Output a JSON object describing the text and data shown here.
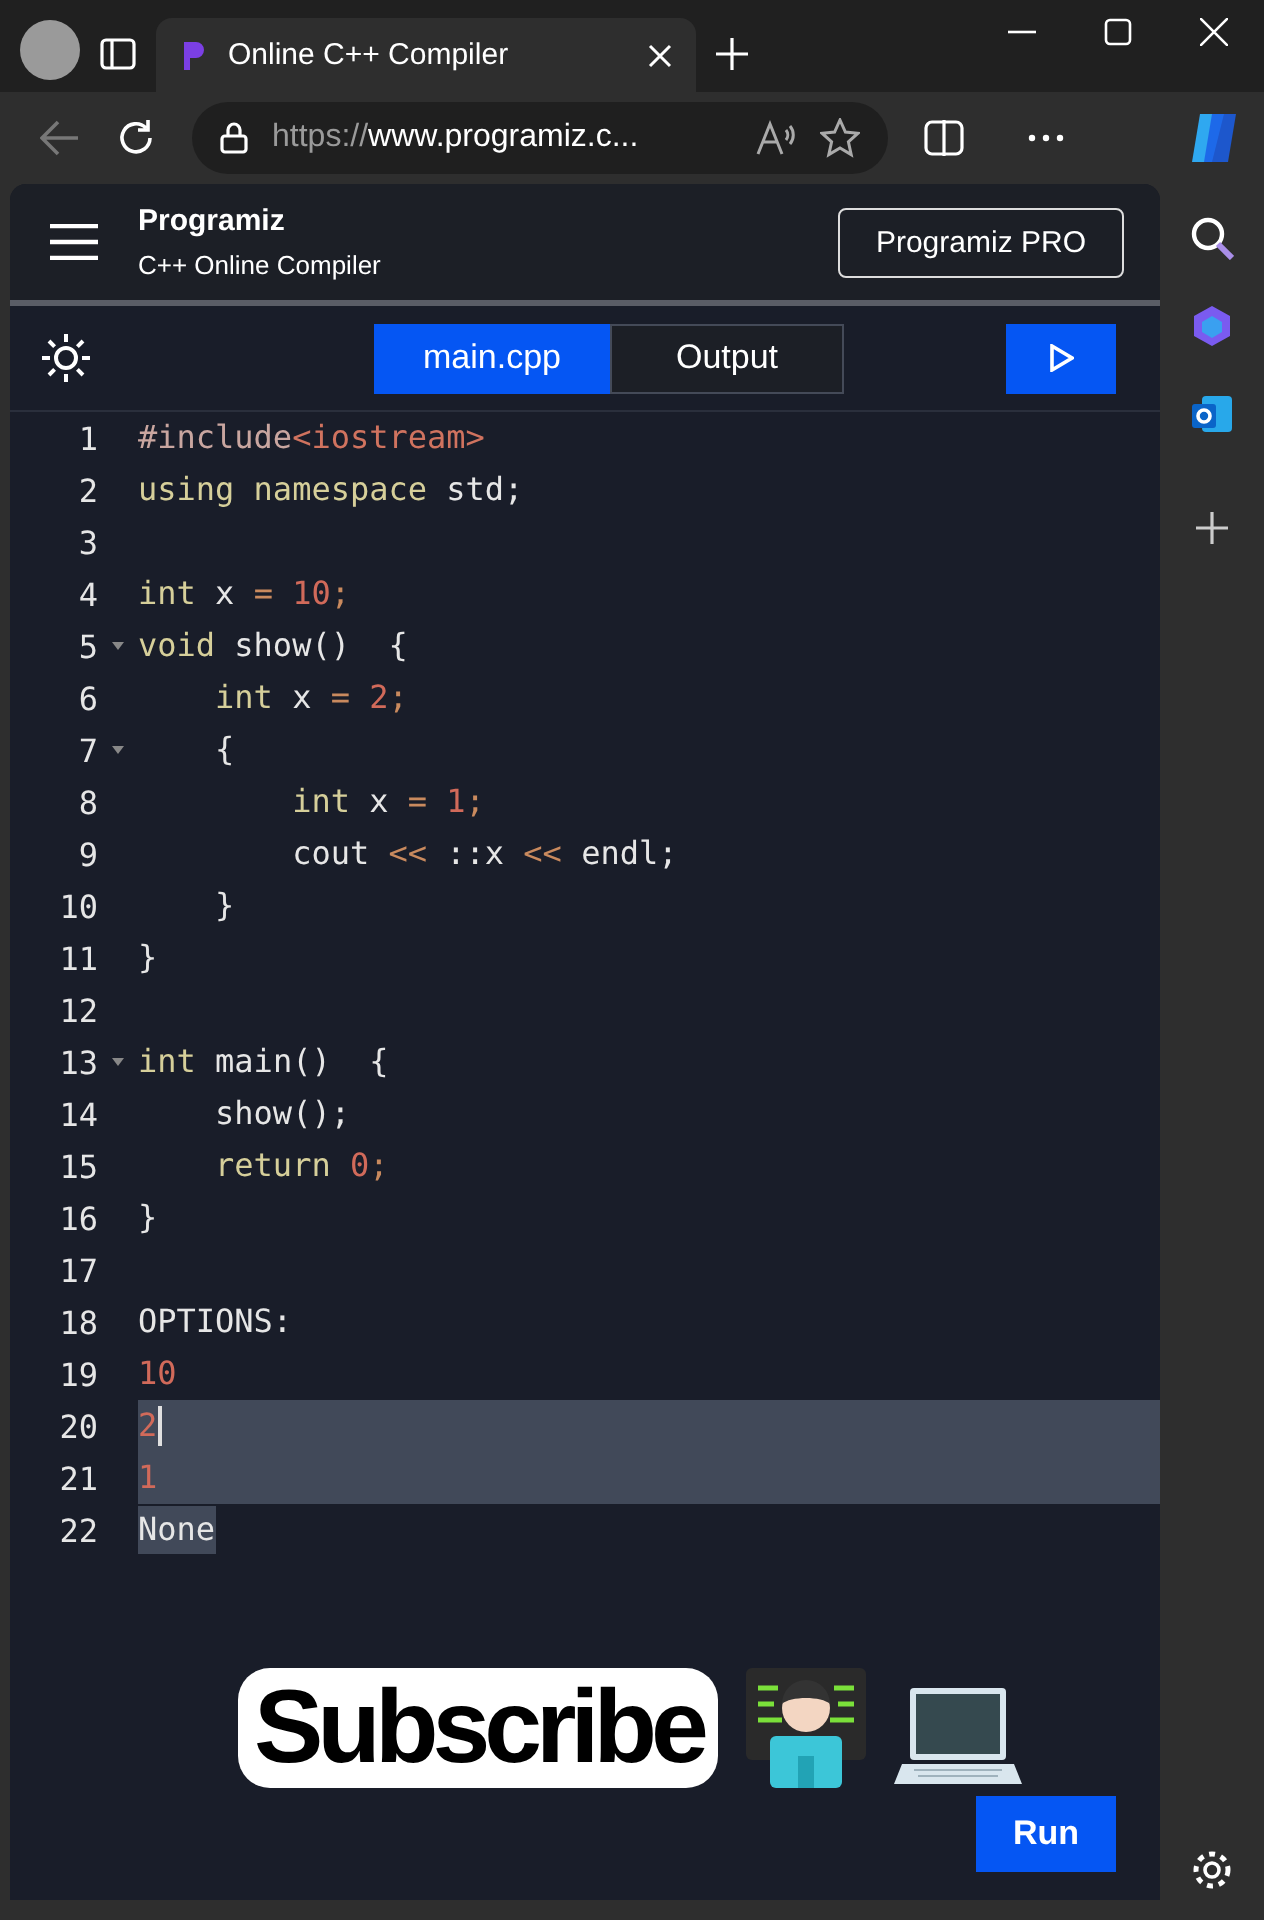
{
  "browser": {
    "tab_title": "Online C++ Compiler",
    "url_scheme": "https://",
    "url_rest": "www.programiz.c..."
  },
  "header": {
    "logo": "Programiz",
    "subtitle": "C++ Online Compiler",
    "pro_button": "Programiz PRO"
  },
  "tabs": [
    {
      "label": "main.cpp",
      "selected": true
    },
    {
      "label": "Output",
      "selected": false
    }
  ],
  "editor": {
    "lines": [
      {
        "number": "1",
        "tokens": [
          {
            "text": "#include",
            "kind": "directive"
          },
          {
            "text": "<iostream>",
            "kind": "string"
          }
        ]
      },
      {
        "number": "2",
        "tokens": [
          {
            "text": "using namespace",
            "kind": "keyword"
          },
          {
            "text": " std;",
            "kind": "plain"
          }
        ]
      },
      {
        "number": "3"
      },
      {
        "number": "4",
        "tokens": [
          {
            "text": "int",
            "kind": "keyword"
          },
          {
            "text": " x ",
            "kind": "plain"
          },
          {
            "text": "=",
            "kind": "operator"
          },
          {
            "text": " 10",
            "kind": "number"
          },
          {
            "text": ";",
            "kind": "operator"
          }
        ]
      },
      {
        "number": "5",
        "foldable": true,
        "tokens": [
          {
            "text": "void",
            "kind": "keyword"
          },
          {
            "text": " show()  {",
            "kind": "plain"
          }
        ]
      },
      {
        "number": "6",
        "tokens": [
          {
            "text": "    int",
            "kind": "keyword"
          },
          {
            "text": " x ",
            "kind": "plain"
          },
          {
            "text": "=",
            "kind": "operator"
          },
          {
            "text": " 2",
            "kind": "number"
          },
          {
            "text": ";",
            "kind": "operator"
          }
        ]
      },
      {
        "number": "7",
        "foldable": true,
        "tokens": [
          {
            "text": "    {",
            "kind": "plain"
          }
        ]
      },
      {
        "number": "8",
        "tokens": [
          {
            "text": "        int",
            "kind": "keyword"
          },
          {
            "text": " x ",
            "kind": "plain"
          },
          {
            "text": "=",
            "kind": "operator"
          },
          {
            "text": " 1",
            "kind": "number"
          },
          {
            "text": ";",
            "kind": "operator"
          }
        ]
      },
      {
        "number": "9",
        "tokens": [
          {
            "text": "        cout ",
            "kind": "plain"
          },
          {
            "text": "<<",
            "kind": "operator"
          },
          {
            "text": " ::x ",
            "kind": "plain"
          },
          {
            "text": "<<",
            "kind": "operator"
          },
          {
            "text": " endl;",
            "kind": "plain"
          }
        ]
      },
      {
        "number": "10",
        "tokens": [
          {
            "text": "    }",
            "kind": "plain"
          }
        ]
      },
      {
        "number": "11",
        "tokens": [
          {
            "text": "}",
            "kind": "plain"
          }
        ]
      },
      {
        "number": "12"
      },
      {
        "number": "13",
        "foldable": true,
        "tokens": [
          {
            "text": "int",
            "kind": "keyword"
          },
          {
            "text": " main()  {",
            "kind": "plain"
          }
        ]
      },
      {
        "number": "14",
        "tokens": [
          {
            "text": "    show();",
            "kind": "plain"
          }
        ]
      },
      {
        "number": "15",
        "tokens": [
          {
            "text": "    return",
            "kind": "keyword"
          },
          {
            "text": " 0",
            "kind": "number"
          },
          {
            "text": ";",
            "kind": "operator"
          }
        ]
      },
      {
        "number": "16",
        "tokens": [
          {
            "text": "}",
            "kind": "plain"
          }
        ]
      },
      {
        "number": "17"
      },
      {
        "number": "18",
        "tokens": [
          {
            "text": "OPTIONS:",
            "kind": "plain"
          }
        ]
      },
      {
        "number": "19",
        "tokens": [
          {
            "text": "10",
            "kind": "number"
          }
        ]
      },
      {
        "number": "20",
        "selected": true,
        "whole_line": true,
        "cursor": true,
        "tokens": [
          {
            "text": "2",
            "kind": "number"
          }
        ]
      },
      {
        "number": "21",
        "selected": true,
        "whole_line": true,
        "tokens": [
          {
            "text": "1",
            "kind": "number"
          }
        ]
      },
      {
        "number": "22",
        "selected": true,
        "tokens": [
          {
            "text": "None",
            "kind": "plain"
          }
        ]
      }
    ]
  },
  "overlay": {
    "text": "Subscribe"
  },
  "run_button": "Run"
}
